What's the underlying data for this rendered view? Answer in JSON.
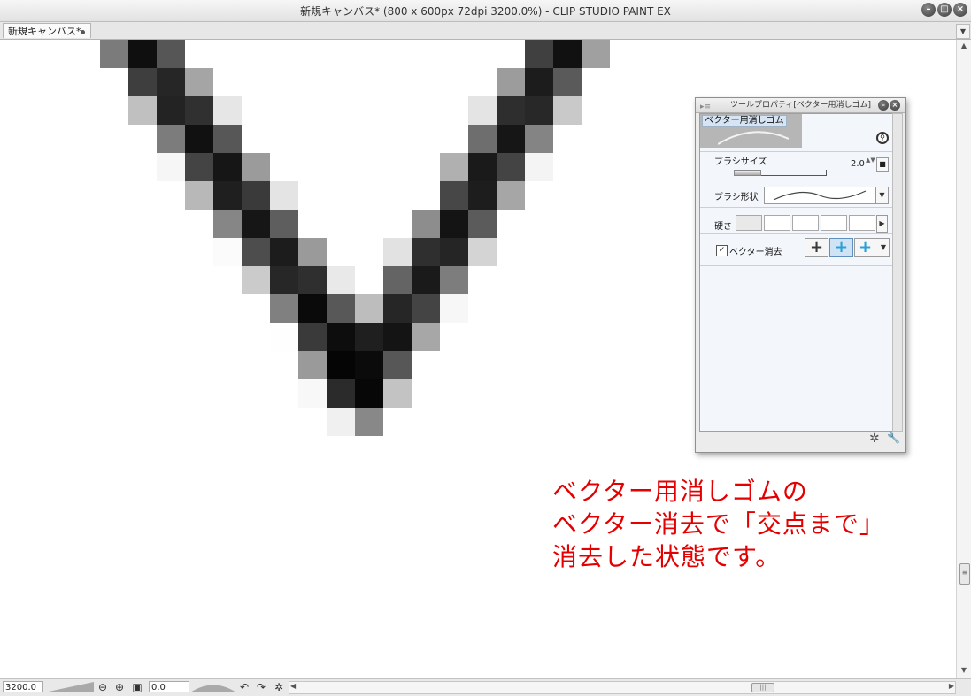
{
  "window": {
    "title": "新規キャンバス* (800 x 600px 72dpi 3200.0%)  - CLIP STUDIO PAINT EX",
    "btn_min": "–",
    "btn_max": "□",
    "btn_close": "×"
  },
  "tabs": [
    {
      "label": "新規キャンバス*"
    }
  ],
  "tab_menu": "▼",
  "canvas": {
    "pixels": [
      [
        3,
        0,
        "#7b7b7b"
      ],
      [
        4,
        0,
        "#0f0f0f"
      ],
      [
        5,
        0,
        "#565656"
      ],
      [
        18,
        0,
        "#404040"
      ],
      [
        19,
        0,
        "#111111"
      ],
      [
        20,
        0,
        "#a0a0a0"
      ],
      [
        4,
        1,
        "#3e3e3e"
      ],
      [
        5,
        1,
        "#262626"
      ],
      [
        6,
        1,
        "#a5a5a5"
      ],
      [
        17,
        1,
        "#9c9c9c"
      ],
      [
        18,
        1,
        "#1c1c1c"
      ],
      [
        19,
        1,
        "#5a5a5a"
      ],
      [
        4,
        2,
        "#c0c0c0"
      ],
      [
        5,
        2,
        "#232323"
      ],
      [
        6,
        2,
        "#303030"
      ],
      [
        7,
        2,
        "#e6e6e6"
      ],
      [
        16,
        2,
        "#e4e4e4"
      ],
      [
        17,
        2,
        "#2e2e2e"
      ],
      [
        18,
        2,
        "#282828"
      ],
      [
        19,
        2,
        "#c9c9c9"
      ],
      [
        5,
        3,
        "#7c7c7c"
      ],
      [
        6,
        3,
        "#111111"
      ],
      [
        7,
        3,
        "#575757"
      ],
      [
        16,
        3,
        "#6e6e6e"
      ],
      [
        17,
        3,
        "#161616"
      ],
      [
        18,
        3,
        "#848484"
      ],
      [
        5,
        4,
        "#f6f6f6"
      ],
      [
        6,
        4,
        "#444444"
      ],
      [
        7,
        4,
        "#161616"
      ],
      [
        8,
        4,
        "#9b9b9b"
      ],
      [
        15,
        4,
        "#b0b0b0"
      ],
      [
        16,
        4,
        "#1a1a1a"
      ],
      [
        17,
        4,
        "#444444"
      ],
      [
        18,
        4,
        "#f4f4f4"
      ],
      [
        6,
        5,
        "#b8b8b8"
      ],
      [
        7,
        5,
        "#1f1f1f"
      ],
      [
        8,
        5,
        "#3a3a3a"
      ],
      [
        9,
        5,
        "#e4e4e4"
      ],
      [
        15,
        5,
        "#474747"
      ],
      [
        16,
        5,
        "#1d1d1d"
      ],
      [
        17,
        5,
        "#a6a6a6"
      ],
      [
        7,
        6,
        "#868686"
      ],
      [
        8,
        6,
        "#161616"
      ],
      [
        9,
        6,
        "#5e5e5e"
      ],
      [
        14,
        6,
        "#8d8d8d"
      ],
      [
        15,
        6,
        "#141414"
      ],
      [
        16,
        6,
        "#5b5b5b"
      ],
      [
        7,
        7,
        "#fbfbfb"
      ],
      [
        8,
        7,
        "#4d4d4d"
      ],
      [
        9,
        7,
        "#1c1c1c"
      ],
      [
        10,
        7,
        "#9a9a9a"
      ],
      [
        13,
        7,
        "#e2e2e2"
      ],
      [
        14,
        7,
        "#2f2f2f"
      ],
      [
        15,
        7,
        "#252525"
      ],
      [
        16,
        7,
        "#d4d4d4"
      ],
      [
        8,
        8,
        "#cbcbcb"
      ],
      [
        9,
        8,
        "#272727"
      ],
      [
        10,
        8,
        "#2f2f2f"
      ],
      [
        11,
        8,
        "#e9e9e9"
      ],
      [
        13,
        8,
        "#646464"
      ],
      [
        14,
        8,
        "#1a1a1a"
      ],
      [
        15,
        8,
        "#7d7d7d"
      ],
      [
        9,
        9,
        "#808080"
      ],
      [
        10,
        9,
        "#0a0a0a"
      ],
      [
        11,
        9,
        "#585858"
      ],
      [
        12,
        9,
        "#bdbdbd"
      ],
      [
        13,
        9,
        "#262626"
      ],
      [
        14,
        9,
        "#444444"
      ],
      [
        15,
        9,
        "#f7f7f7"
      ],
      [
        9,
        10,
        "#fefefe"
      ],
      [
        10,
        10,
        "#3a3a3a"
      ],
      [
        11,
        10,
        "#0d0d0d"
      ],
      [
        12,
        10,
        "#1f1f1f"
      ],
      [
        13,
        10,
        "#141414"
      ],
      [
        14,
        10,
        "#a7a7a7"
      ],
      [
        10,
        11,
        "#9a9a9a"
      ],
      [
        11,
        11,
        "#050505"
      ],
      [
        12,
        11,
        "#0b0b0b"
      ],
      [
        13,
        11,
        "#575757"
      ],
      [
        10,
        12,
        "#f8f8f8"
      ],
      [
        11,
        12,
        "#2b2b2b"
      ],
      [
        12,
        12,
        "#070707"
      ],
      [
        13,
        12,
        "#c3c3c3"
      ],
      [
        11,
        13,
        "#f0f0f0"
      ],
      [
        12,
        13,
        "#888888"
      ]
    ]
  },
  "statusbar": {
    "zoom_value": "3200.0",
    "angle_value": "0.0",
    "zoom_out_icon": "⊖",
    "zoom_in_icon": "⊕",
    "fit_icon": "▣",
    "rotate_left_icon": "↶",
    "rotate_right_icon": "↷",
    "reset_icon": "✲",
    "scroll_left": "◀",
    "scroll_right": "▶",
    "thumb_grip": "|||"
  },
  "vscroll": {
    "up": "▲",
    "down": "▼",
    "grip": "≡"
  },
  "tool_property": {
    "title": "ツールプロパティ[ベクター用消しゴム]",
    "grip": "▸≡",
    "btn_min": "–",
    "btn_close": "×",
    "preset_name": "ベクター用消しゴム",
    "preset_icon": "⚲",
    "brush_size_label": "ブラシサイズ",
    "brush_size_value": "2.0",
    "brush_size_fraction": 0.02,
    "spinner": "▲▼",
    "brush_size_btn": "■",
    "brush_shape_label": "ブラシ形状",
    "dropdown_arrow": "▼",
    "hardness_label": "硬さ",
    "hardness_arrow": "▶",
    "hardness_level": 1,
    "vector_erase_label": "ベクター消去",
    "vector_erase_checked": "✓",
    "mode_icons": [
      "+",
      "+",
      "+"
    ],
    "mode_colors": [
      "#3a3a3a",
      "#2aa0d8",
      "#2aa0d8"
    ],
    "mode_dropdown": "▼",
    "foot_icons": [
      "✲",
      "🔧"
    ]
  },
  "annotation": {
    "line1": "ベクター用消しゴムの",
    "line2": "ベクター消去で「交点まで」",
    "line3": "消去した状態です。",
    "color": "#e40000"
  }
}
